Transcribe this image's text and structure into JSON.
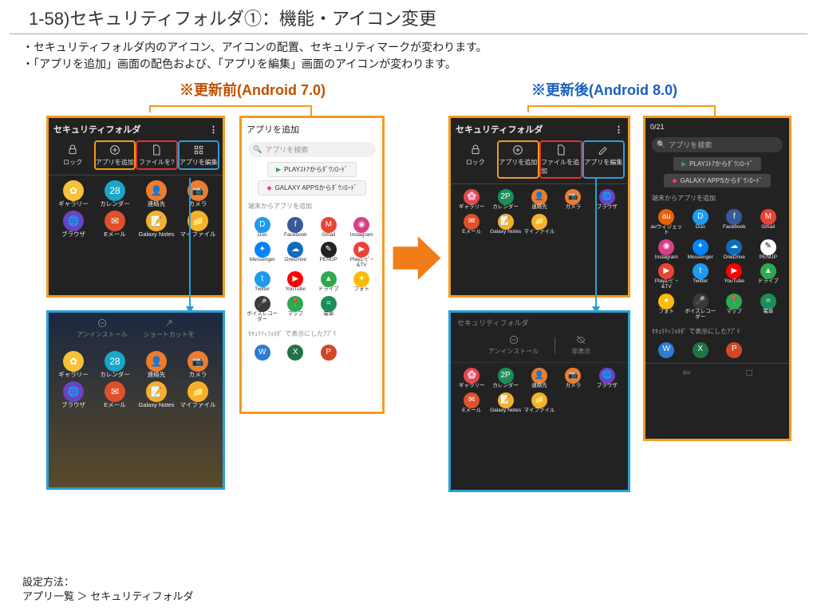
{
  "title": "1-58)セキュリティフォルダ①：機能・アイコン変更",
  "desc1": "・セキュリティフォルダ内のアイコン、アイコンの配置、セキュリティマークが変わります。",
  "desc2": "・「アプリを追加」画面の配色および、「アプリを編集」画面のアイコンが変わります。",
  "headBefore": "※更新前(Android 7.0)",
  "headAfter": "※更新後(Android 8.0)",
  "sf_title": "セキュリティフォルダ",
  "tool": {
    "lock": "ロック",
    "add": "アプリを追加",
    "file7": "ファイルを?",
    "file8": "ファイルを追加",
    "edit": "アプリを編集"
  },
  "apps7_row1": [
    {
      "label": "ギャラリー",
      "bg": "#f6c23a",
      "ch": "✿"
    },
    {
      "label": "カレンダー",
      "bg": "#1aa6c9",
      "ch": "28"
    },
    {
      "label": "連絡先",
      "bg": "#f07b2a",
      "ch": "👤"
    },
    {
      "label": "カメラ",
      "bg": "#f07b2a",
      "ch": "📷"
    }
  ],
  "apps7_row2": [
    {
      "label": "ブラウザ",
      "bg": "#6a43c5",
      "ch": "🌐"
    },
    {
      "label": "Eメール",
      "bg": "#e0502a",
      "ch": "✉"
    },
    {
      "label": "Galaxy Notes",
      "bg": "#f6b12a",
      "ch": "📝"
    },
    {
      "label": "マイファイル",
      "bg": "#f6b12a",
      "ch": "📁"
    }
  ],
  "apps8_row1": [
    {
      "label": "ギャラリー",
      "bg": "#e04a4a",
      "ch": "🌸"
    },
    {
      "label": "カレンダー",
      "bg": "#1b8e5a",
      "ch": "2P"
    },
    {
      "label": "連絡先",
      "bg": "#f07b2a",
      "ch": "👤"
    },
    {
      "label": "カメラ",
      "bg": "#f07b2a",
      "ch": "📷"
    },
    {
      "label": "ブラウザ",
      "bg": "#6a43c5",
      "ch": "🌐"
    }
  ],
  "apps8_row2": [
    {
      "label": "Eメール",
      "bg": "#e0502a",
      "ch": "✉"
    },
    {
      "label": "Galaxy Notes",
      "bg": "#f6b12a",
      "ch": "📝"
    },
    {
      "label": "マイファイル",
      "bg": "#f6b12a",
      "ch": "📁"
    }
  ],
  "addApp": {
    "title": "アプリを追加",
    "search": "アプリを検索",
    "btnPlay": "PLAYｽﾄｱからﾀﾞｳﾝﾛｰﾄﾞ",
    "btnGalaxy": "GALAXY APPSからﾀﾞｳﾝﾛｰﾄﾞ",
    "section": "端末からアプリを追加",
    "apps": [
      {
        "label": "Duo",
        "bg": "#1d9bf0",
        "ch": "D"
      },
      {
        "label": "Facebook",
        "bg": "#3b5998",
        "ch": "f"
      },
      {
        "label": "Gmail",
        "bg": "#ea4335",
        "ch": "M"
      },
      {
        "label": "Instagram",
        "bg": "#d83f87",
        "ch": "◉"
      },
      {
        "label": "Messenger",
        "bg": "#0084ff",
        "ch": "✦"
      },
      {
        "label": "OneDrive",
        "bg": "#0f6cbd",
        "ch": "☁"
      },
      {
        "label": "PENUP",
        "bg": "#222",
        "ch": "✎"
      },
      {
        "label": "Playﾑｰﾋﾞｰ&TV",
        "bg": "#ea4335",
        "ch": "▶"
      },
      {
        "label": "Twitter",
        "bg": "#1d9bf0",
        "ch": "t"
      },
      {
        "label": "YouTube",
        "bg": "#ff0000",
        "ch": "▶"
      },
      {
        "label": "ドライブ",
        "bg": "#2da94f",
        "ch": "▲"
      },
      {
        "label": "フォト",
        "bg": "#fbbc05",
        "ch": "✦"
      },
      {
        "label": "ボイスレコーダー",
        "bg": "#3a3a3a",
        "ch": "🎤"
      },
      {
        "label": "マップ",
        "bg": "#2da94f",
        "ch": "📍"
      },
      {
        "label": "電卓",
        "bg": "#1b8e5a",
        "ch": "="
      }
    ],
    "sectionSecure": "ｾｷｭﾘﾃｨﾌｫﾙﾀﾞ で表示にしたｱﾌﾟﾘ",
    "secureApps": [
      {
        "label": "",
        "bg": "#2b7cd3",
        "ch": "W"
      },
      {
        "label": "",
        "bg": "#217346",
        "ch": "X"
      },
      {
        "label": "",
        "bg": "#d24726",
        "ch": "P"
      }
    ]
  },
  "addApp8": {
    "counter": "0/21",
    "apps": [
      {
        "label": "auウィジェット",
        "bg": "#eb6100",
        "ch": "au"
      },
      {
        "label": "Duo",
        "bg": "#1d9bf0",
        "ch": "D"
      },
      {
        "label": "Facebook",
        "bg": "#3b5998",
        "ch": "f"
      },
      {
        "label": "Gmail",
        "bg": "#ea4335",
        "ch": "M"
      },
      {
        "label": "Instagram",
        "bg": "#d83f87",
        "ch": "◉"
      },
      {
        "label": "Messenger",
        "bg": "#0084ff",
        "ch": "✦"
      },
      {
        "label": "OneDrive",
        "bg": "#0f6cbd",
        "ch": "☁"
      },
      {
        "label": "PENUP",
        "bg": "#fff",
        "ch": "✎",
        "fg": "#000"
      },
      {
        "label": "Playﾑｰﾋﾞｰ&TV",
        "bg": "#ea4335",
        "ch": "▶"
      },
      {
        "label": "Twitter",
        "bg": "#1d9bf0",
        "ch": "t"
      },
      {
        "label": "YouTube",
        "bg": "#ff0000",
        "ch": "▶"
      },
      {
        "label": "ドライブ",
        "bg": "#2da94f",
        "ch": "▲"
      },
      {
        "label": "フォト",
        "bg": "#fbbc05",
        "ch": "✦"
      },
      {
        "label": "ボイスレコーダー",
        "bg": "#3a3a3a",
        "ch": "🎤"
      },
      {
        "label": "マップ",
        "bg": "#2da94f",
        "ch": "📍"
      },
      {
        "label": "電卓",
        "bg": "#1b8e5a",
        "ch": "="
      }
    ]
  },
  "edit7": {
    "uninstall": "アンインストール",
    "shortcut": "ショートカットを"
  },
  "edit8": {
    "uninstall": "アンインストール",
    "hide": "非表示"
  },
  "footer1": "設定方法：",
  "footer2": "アプリ一覧 ＞ セキュリティフォルダ"
}
